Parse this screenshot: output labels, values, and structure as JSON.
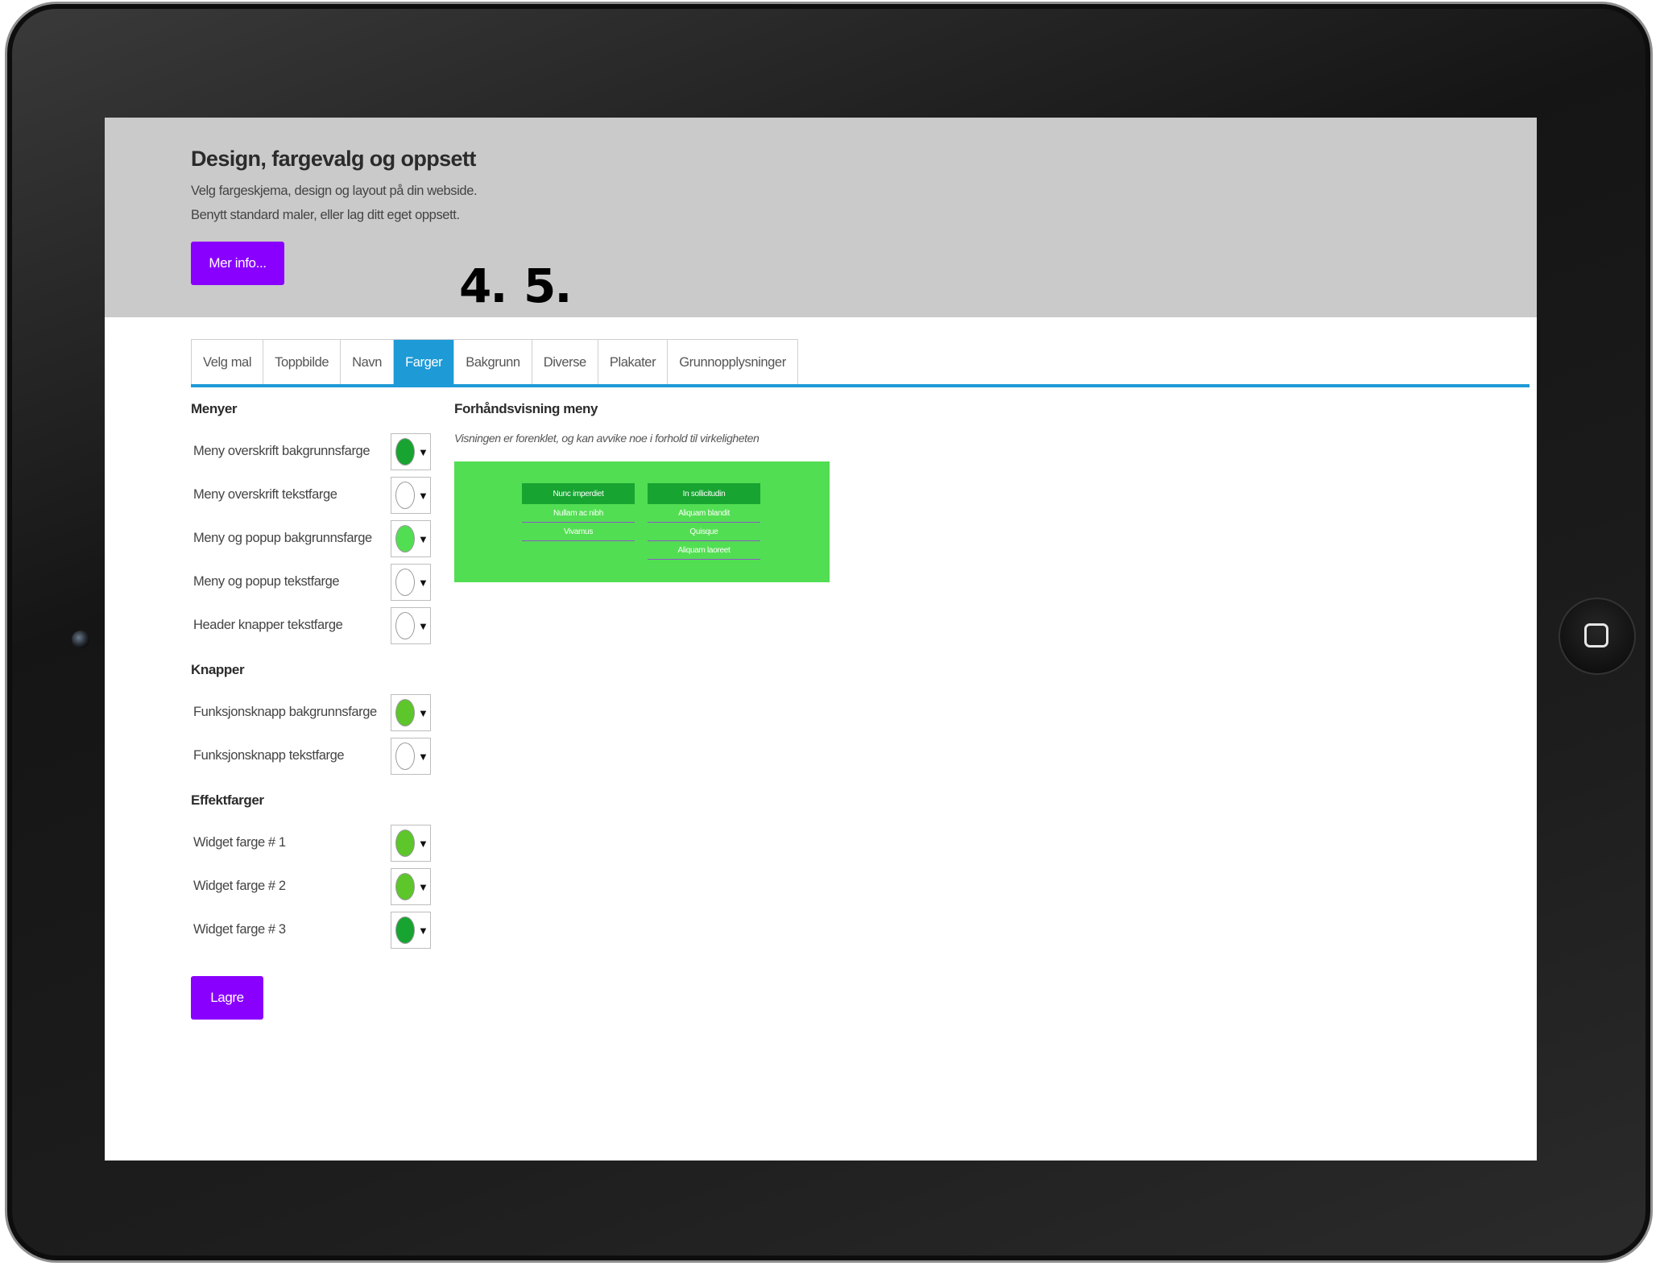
{
  "header": {
    "title": "Design, fargevalg og oppsett",
    "description": "Velg fargeskjema, design og layout på din webside. Benytt standard maler, eller lag ditt eget oppsett.",
    "more_button": "Mer info..."
  },
  "step_markers": [
    "4.",
    "5."
  ],
  "tabs": [
    {
      "label": "Velg mal",
      "active": false
    },
    {
      "label": "Toppbilde",
      "active": false
    },
    {
      "label": "Navn",
      "active": false
    },
    {
      "label": "Farger",
      "active": true
    },
    {
      "label": "Bakgrunn",
      "active": false
    },
    {
      "label": "Diverse",
      "active": false
    },
    {
      "label": "Plakater",
      "active": false
    },
    {
      "label": "Grunnopplysninger",
      "active": false
    }
  ],
  "sections": {
    "menus": {
      "heading": "Menyer",
      "items": [
        {
          "label": "Meny overskrift bakgrunnsfarge",
          "color": "#17a431"
        },
        {
          "label": "Meny overskrift tekstfarge",
          "color": "#ffffff"
        },
        {
          "label": "Meny og popup bakgrunnsfarge",
          "color": "#52de52"
        },
        {
          "label": "Meny og popup tekstfarge",
          "color": "#ffffff"
        },
        {
          "label": "Header knapper tekstfarge",
          "color": "#ffffff"
        }
      ]
    },
    "buttons": {
      "heading": "Knapper",
      "items": [
        {
          "label": "Funksjonsknapp bakgrunnsfarge",
          "color": "#5cc62a"
        },
        {
          "label": "Funksjonsknapp tekstfarge",
          "color": "#ffffff"
        }
      ]
    },
    "effects": {
      "heading": "Effektfarger",
      "items": [
        {
          "label": "Widget farge # 1",
          "color": "#5cc62a"
        },
        {
          "label": "Widget farge # 2",
          "color": "#5cc62a"
        },
        {
          "label": "Widget farge # 3",
          "color": "#17a431"
        }
      ]
    }
  },
  "save_button": "Lagre",
  "preview": {
    "title": "Forhåndsvisning meny",
    "note": "Visningen er forenklet, og kan avvike noe i forhold til virkeligheten",
    "menu1": {
      "header": "Nunc imperdiet",
      "items": [
        "Nullam ac nibh",
        "Vivamus"
      ]
    },
    "menu2": {
      "header": "In sollicitudin",
      "items": [
        "Aliquam blandit",
        "Quisque",
        "Aliquam laoreet"
      ]
    }
  },
  "colors": {
    "accent": "#8a00ff",
    "tab_active": "#1e9ad6",
    "preview_bg": "#52de52",
    "preview_header": "#17a431"
  }
}
